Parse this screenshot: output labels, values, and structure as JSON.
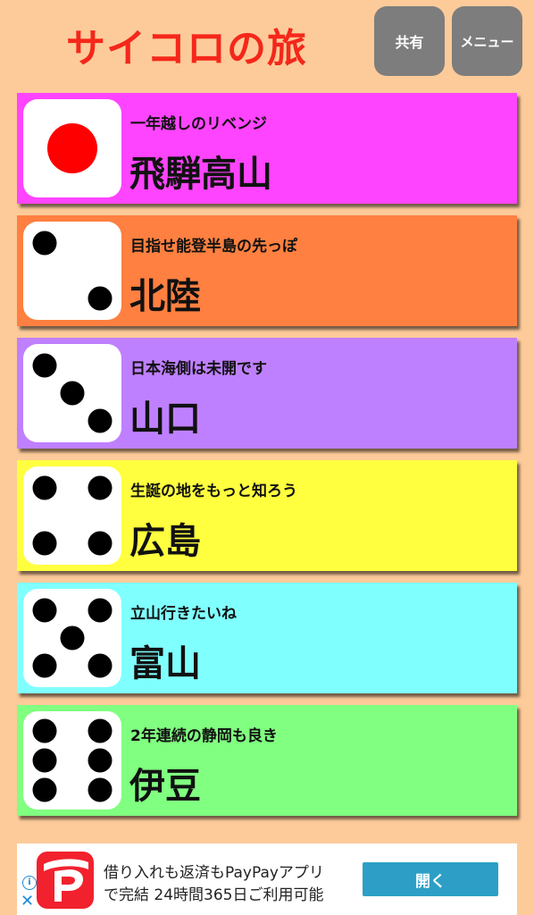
{
  "header": {
    "title": "サイコロの旅",
    "share_label": "共有",
    "menu_label": "メニュー",
    "title_color": "#f5271a",
    "button_color": "#7d7d7d"
  },
  "cards": [
    {
      "face": 1,
      "subtitle": "一年越しのリベンジ",
      "place": "飛騨高山",
      "color": "#ff44ff"
    },
    {
      "face": 2,
      "subtitle": "目指せ能登半島の先っぽ",
      "place": "北陸",
      "color": "#ff8040"
    },
    {
      "face": 3,
      "subtitle": "日本海側は未開です",
      "place": "山口",
      "color": "#bf80ff"
    },
    {
      "face": 4,
      "subtitle": "生誕の地をもっと知ろう",
      "place": "広島",
      "color": "#ffff40"
    },
    {
      "face": 5,
      "subtitle": "立山行きたいね",
      "place": "富山",
      "color": "#80ffff"
    },
    {
      "face": 6,
      "subtitle": "2年連続の静岡も良き",
      "place": "伊豆",
      "color": "#80ff80"
    }
  ],
  "ad": {
    "line1": "借り入れも返済もPayPayアプリ",
    "line2": "で完結 24時間365日ご利用可能",
    "open_label": "開く",
    "info_icon": "info-icon",
    "close_icon": "close-icon",
    "logo_icon": "paypay-logo-icon",
    "logo_color": "#f2212e",
    "button_color": "#2d9fc6"
  }
}
